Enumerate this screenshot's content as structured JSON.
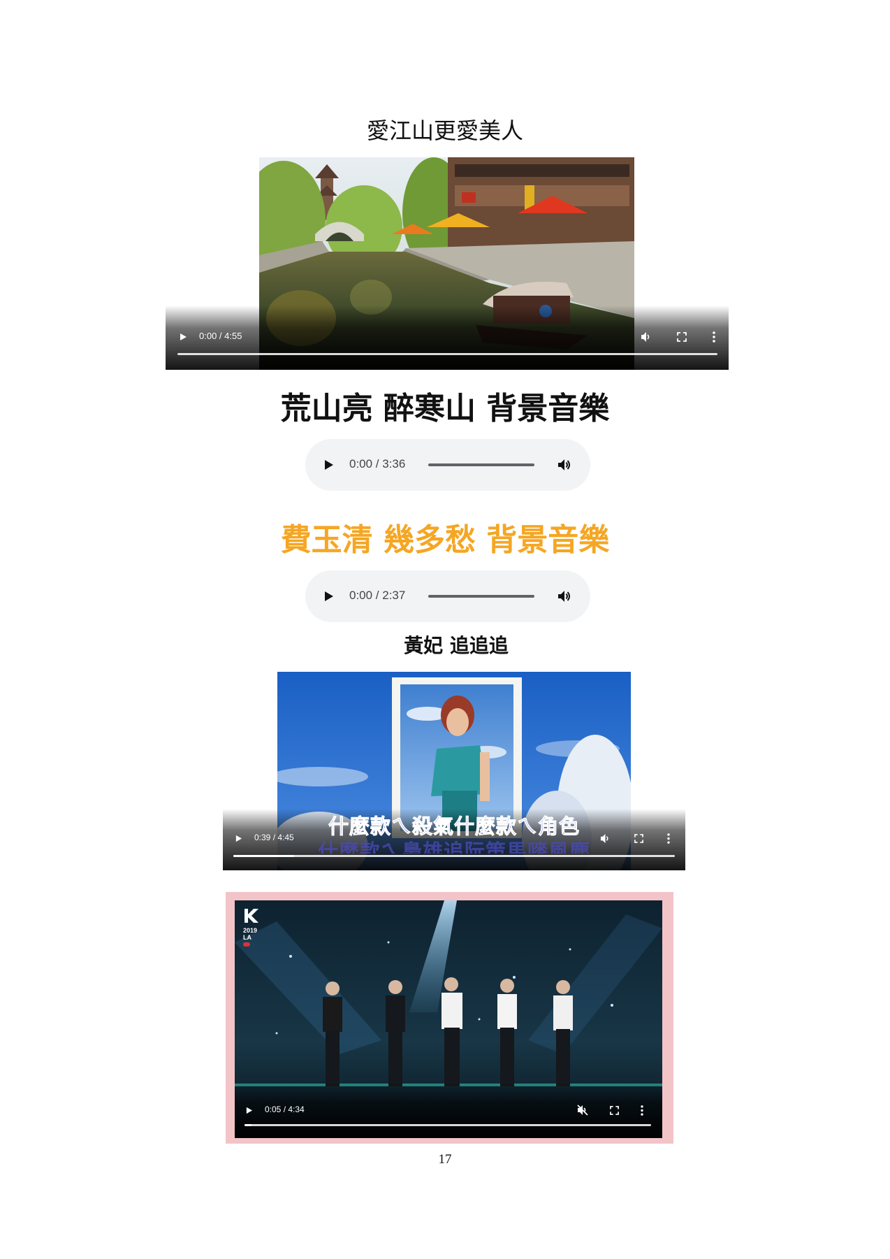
{
  "headings": {
    "song1": "愛江山更愛美人",
    "song2": "荒山亮 醉寒山 背景音樂",
    "song3": "費玉清 幾多愁 背景音樂",
    "song4": "黃妃 追追追"
  },
  "video1": {
    "time": "0:00 / 4:55",
    "progress": 0
  },
  "audio1": {
    "time": "0:00 / 3:36"
  },
  "audio2": {
    "time": "0:00 / 2:37"
  },
  "video2": {
    "time": "0:39 / 4:45",
    "progress": 0.137,
    "lyric_line1": "什麼款ㄟ殺氣什麼款ㄟ角色",
    "lyric_line2": "什麼款ㄟ梟雄追阮策馬嘜風塵"
  },
  "video3": {
    "time": "0:05 / 4:34",
    "progress": 0.018,
    "muted": true,
    "logo_line1": "2019",
    "logo_line2": "LA"
  },
  "page_number": "17",
  "colors": {
    "song3_heading": "#f5a623",
    "video3_frame": "#f2c4c8",
    "audio_background": "#f1f3f4"
  },
  "icons": [
    "play-icon",
    "volume-icon",
    "fullscreen-icon",
    "more-options-icon",
    "volume-muted-icon"
  ]
}
